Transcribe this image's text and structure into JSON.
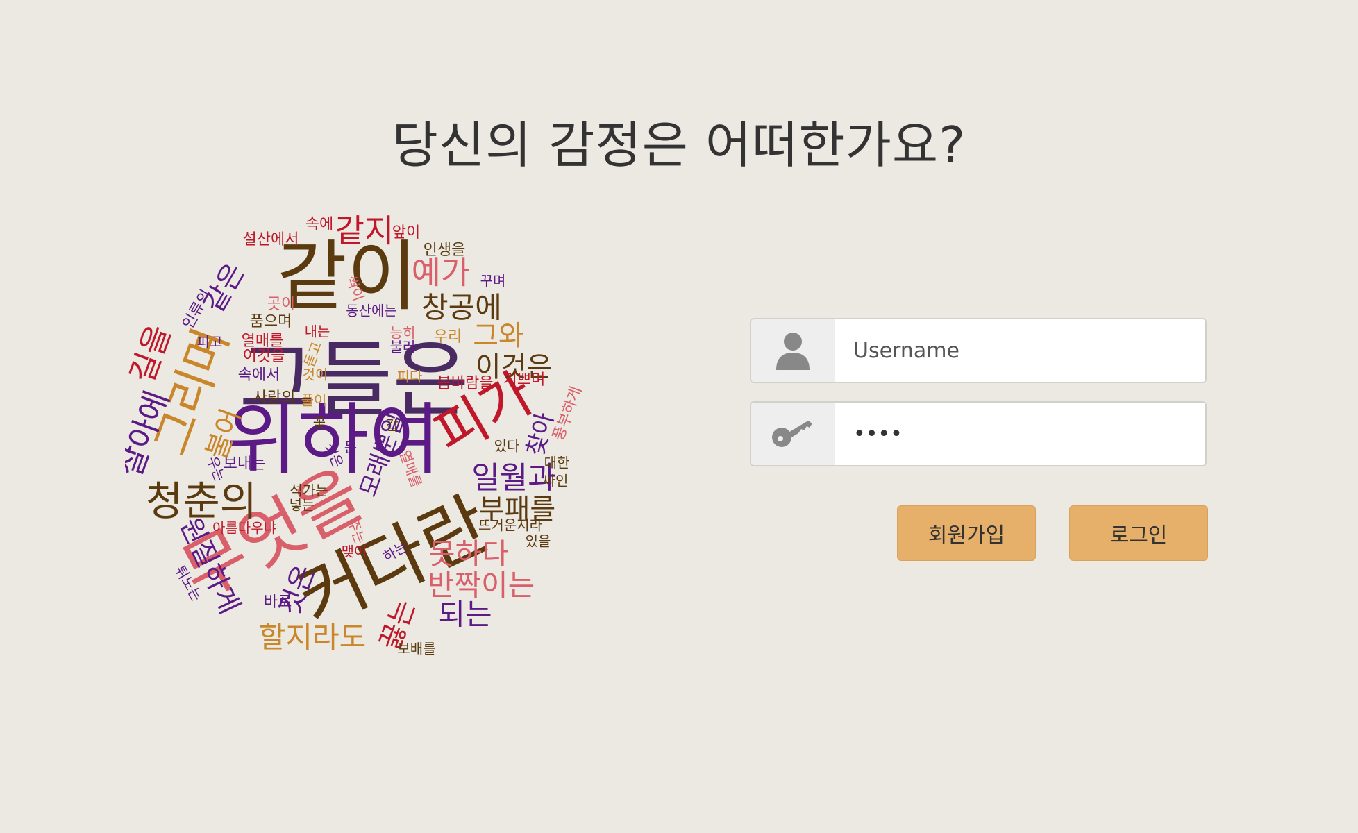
{
  "page": {
    "title": "당신의 감정은 어떠한가요?"
  },
  "wordcloud": {
    "colors": {
      "dark_purple": "#4a2a63",
      "purple": "#5b1a86",
      "brown": "#5b3a10",
      "orange": "#c9862a",
      "pink": "#d95f6a",
      "red": "#c0182a"
    },
    "words": [
      {
        "text": "같이",
        "color": "brown"
      },
      {
        "text": "그들은",
        "color": "dark_purple"
      },
      {
        "text": "위하여",
        "color": "purple"
      },
      {
        "text": "무엇을",
        "color": "pink"
      },
      {
        "text": "커다란",
        "color": "brown"
      },
      {
        "text": "피가",
        "color": "red"
      },
      {
        "text": "청춘의",
        "color": "brown"
      },
      {
        "text": "그리며",
        "color": "orange"
      },
      {
        "text": "같지",
        "color": "red"
      },
      {
        "text": "예가",
        "color": "pink"
      },
      {
        "text": "창공에",
        "color": "brown"
      },
      {
        "text": "그와",
        "color": "orange"
      },
      {
        "text": "이것은",
        "color": "brown"
      },
      {
        "text": "일월과",
        "color": "purple"
      },
      {
        "text": "부패를",
        "color": "brown"
      },
      {
        "text": "못하다",
        "color": "pink"
      },
      {
        "text": "반짝이는",
        "color": "pink"
      },
      {
        "text": "되는",
        "color": "purple"
      },
      {
        "text": "할지라도",
        "color": "orange"
      },
      {
        "text": "끓는",
        "color": "red"
      },
      {
        "text": "것은",
        "color": "purple"
      },
      {
        "text": "원질하게",
        "color": "purple"
      },
      {
        "text": "살아에",
        "color": "purple"
      },
      {
        "text": "길을",
        "color": "red"
      },
      {
        "text": "같은",
        "color": "purple"
      },
      {
        "text": "불어",
        "color": "orange"
      },
      {
        "text": "모래뿐일",
        "color": "purple"
      },
      {
        "text": "찾아",
        "color": "purple"
      },
      {
        "text": "풍부하게",
        "color": "pink"
      },
      {
        "text": "설산에서",
        "color": "red"
      },
      {
        "text": "속에",
        "color": "red"
      },
      {
        "text": "앞이",
        "color": "red"
      },
      {
        "text": "인생을",
        "color": "brown"
      },
      {
        "text": "꾸며",
        "color": "purple"
      },
      {
        "text": "싹이",
        "color": "pink"
      },
      {
        "text": "동산에는",
        "color": "purple"
      },
      {
        "text": "인류의",
        "color": "purple"
      },
      {
        "text": "곳이",
        "color": "pink"
      },
      {
        "text": "품으며",
        "color": "brown"
      },
      {
        "text": "피고",
        "color": "purple"
      },
      {
        "text": "열매를",
        "color": "red"
      },
      {
        "text": "이것을",
        "color": "red"
      },
      {
        "text": "내는",
        "color": "red"
      },
      {
        "text": "능히",
        "color": "pink"
      },
      {
        "text": "우리",
        "color": "orange"
      },
      {
        "text": "돋고",
        "color": "orange"
      },
      {
        "text": "불러",
        "color": "purple"
      },
      {
        "text": "속에서",
        "color": "purple"
      },
      {
        "text": "것이",
        "color": "orange"
      },
      {
        "text": "피다",
        "color": "orange"
      },
      {
        "text": "봄바람을",
        "color": "red"
      },
      {
        "text": "기쁘며",
        "color": "red"
      },
      {
        "text": "사랑의",
        "color": "brown"
      },
      {
        "text": "풀이",
        "color": "orange"
      },
      {
        "text": "꽃",
        "color": "brown"
      },
      {
        "text": "갑",
        "color": "brown"
      },
      {
        "text": "든",
        "color": "purple"
      },
      {
        "text": "있다",
        "color": "brown"
      },
      {
        "text": "대한",
        "color": "brown"
      },
      {
        "text": "싸인",
        "color": "brown"
      },
      {
        "text": "보내는",
        "color": "purple"
      },
      {
        "text": "우는",
        "color": "purple"
      },
      {
        "text": "석가는",
        "color": "brown"
      },
      {
        "text": "넣는",
        "color": "brown"
      },
      {
        "text": "뜨거운지라",
        "color": "brown"
      },
      {
        "text": "아름다우냐",
        "color": "red"
      },
      {
        "text": "있을",
        "color": "brown"
      },
      {
        "text": "맺어",
        "color": "red"
      },
      {
        "text": "하는",
        "color": "purple"
      },
      {
        "text": "튀노는",
        "color": "purple"
      },
      {
        "text": "바로",
        "color": "purple"
      },
      {
        "text": "보배를",
        "color": "brown"
      },
      {
        "text": "열매를",
        "color": "pink"
      },
      {
        "text": "주는",
        "color": "pink"
      },
      {
        "text": "것은",
        "color": "purple"
      }
    ]
  },
  "login": {
    "username": {
      "placeholder": "Username",
      "value": "",
      "icon": "user-icon"
    },
    "password": {
      "placeholder": "",
      "value": "1234",
      "icon": "key-icon"
    },
    "signup_label": "회원가입",
    "login_label": "로그인",
    "button_color": "#e6b06a"
  }
}
